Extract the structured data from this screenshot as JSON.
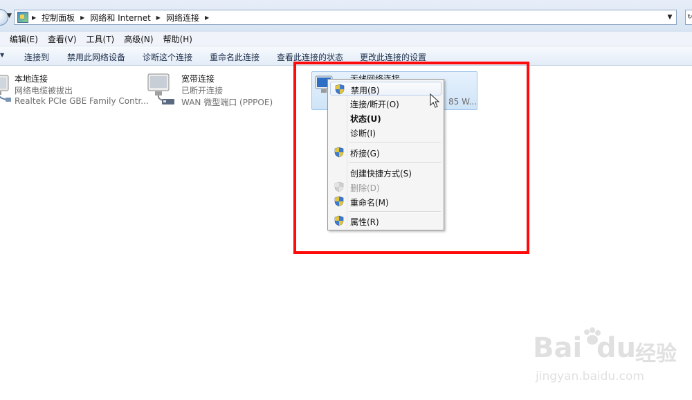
{
  "address": {
    "crumbs": [
      "控制面板",
      "网络和 Internet",
      "网络连接"
    ]
  },
  "menubar": {
    "items": [
      "编辑(E)",
      "查看(V)",
      "工具(T)",
      "高级(N)",
      "帮助(H)"
    ]
  },
  "commandbar": {
    "items": [
      "连接到",
      "禁用此网络设备",
      "诊断这个连接",
      "重命名此连接",
      "查看此连接的状态",
      "更改此连接的设置"
    ]
  },
  "connections": [
    {
      "name": "本地连接",
      "status": "网络电缆被拔出",
      "device": "Realtek PCIe GBE Family Contr..."
    },
    {
      "name": "宽带连接",
      "status": "已断开连接",
      "device": "WAN 微型端口 (PPPOE)"
    },
    {
      "name": "无线网络连接",
      "device_tail": "85 W..."
    }
  ],
  "context_menu": {
    "items": [
      {
        "label": "禁用(B)",
        "shield": true,
        "state": "hover"
      },
      {
        "label": "连接/断开(O)",
        "shield": false
      },
      {
        "label": "状态(U)",
        "shield": false,
        "bold": true
      },
      {
        "label": "诊断(I)",
        "shield": false
      },
      {
        "label": "桥接(G)",
        "shield": true
      },
      {
        "label": "创建快捷方式(S)",
        "shield": false
      },
      {
        "label": "删除(D)",
        "shield": true,
        "disabled": true
      },
      {
        "label": "重命名(M)",
        "shield": true
      },
      {
        "label": "属性(R)",
        "shield": true
      }
    ]
  },
  "watermark": {
    "brand": "Bai",
    "brand2": "du",
    "cn": "经验",
    "url": "jingyan.baidu.com"
  },
  "colors": {
    "highlight_red": "#ff0a0a",
    "selection_blue": "#cfe4f8"
  }
}
